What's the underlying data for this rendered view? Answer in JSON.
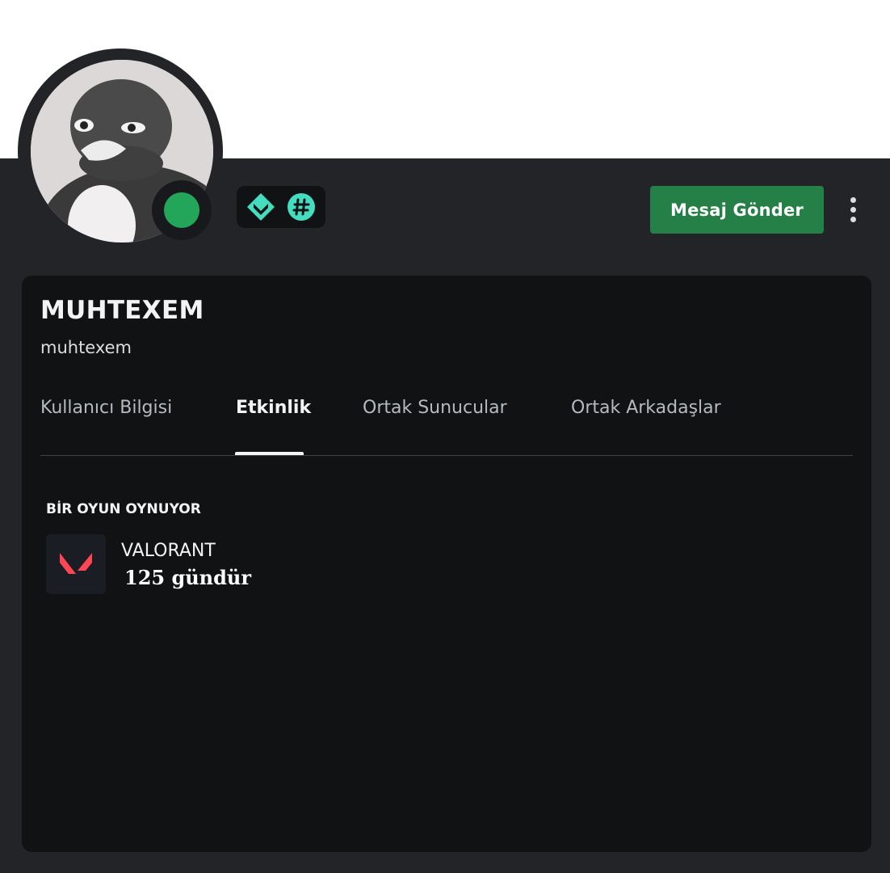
{
  "profile": {
    "display_name": "MUHTEXEM",
    "username": "muhtexem",
    "status": "online",
    "status_color": "#23a55a",
    "banner_color": "#ffffff",
    "badges": [
      {
        "icon": "hypesquad-balance-icon",
        "color": "#45ddc0"
      },
      {
        "icon": "hashtag-badge-icon",
        "color": "#45ddc0"
      }
    ]
  },
  "actions": {
    "message_label": "Mesaj Gönder",
    "message_color": "#248046",
    "more_icon": "more-vertical-icon"
  },
  "tabs": [
    {
      "label": "Kullanıcı Bilgisi",
      "active": false
    },
    {
      "label": "Etkinlik",
      "active": true
    },
    {
      "label": "Ortak Sunucular",
      "active": false
    },
    {
      "label": "Ortak Arkadaşlar",
      "active": false
    }
  ],
  "activity": {
    "section_title": "BİR OYUN OYNUYOR",
    "game_name": "VALORANT",
    "duration": "125 gündür",
    "game_icon": "valorant-logo-icon",
    "game_icon_color": "#ff4655"
  }
}
